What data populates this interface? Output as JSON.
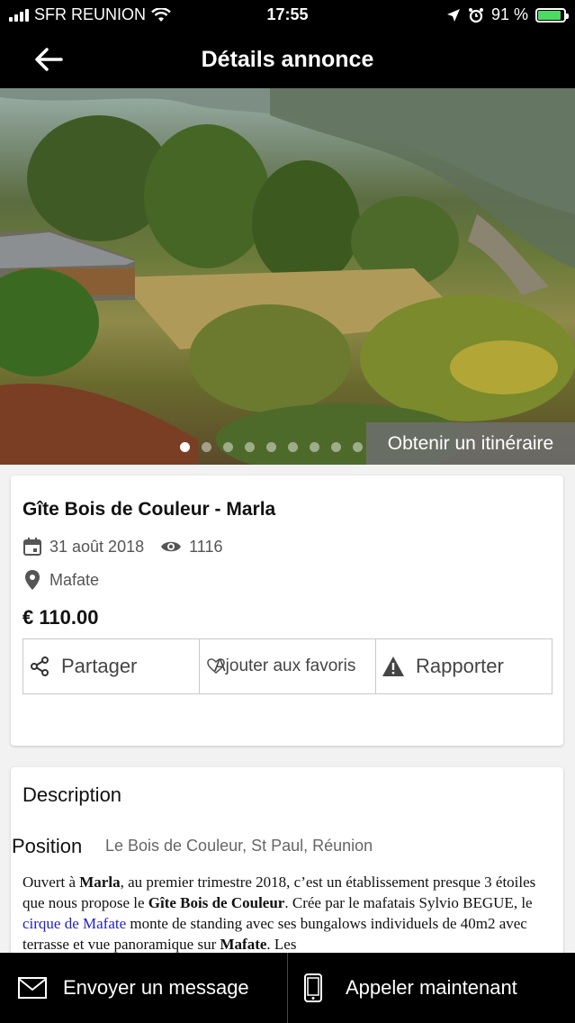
{
  "status_bar": {
    "carrier": "SFR REUNION",
    "time": "17:55",
    "battery": "91 %",
    "battery_level": 0.91
  },
  "nav": {
    "title": "Détails annonce",
    "back_icon": "arrow-left-icon"
  },
  "hero": {
    "itinerary_label": "Obtenir un itinéraire",
    "slide_count": 9,
    "active_slide": 0
  },
  "listing": {
    "title": "Gîte Bois de Couleur - Marla",
    "date": "31 août 2018",
    "views": "1116",
    "location": "Mafate",
    "price": "€ 110.00"
  },
  "actions": {
    "share": "Partager",
    "favorite": "Ajouter aux favoris",
    "report": "Rapporter"
  },
  "description": {
    "title": "Description",
    "position_label": "Position",
    "position_value": "Le Bois de Couleur, St Paul, Réunion",
    "p1": "Ouvert à ",
    "b1": "Marla",
    "p2": ", au premier trimestre 2018, c’est un établissement presque 3 étoiles que nous propose le ",
    "b2": "Gîte Bois de Couleur",
    "p3": ". Crée par le mafatais Sylvio BEGUE, le ",
    "link": "cirque de Mafate",
    "p4": " monte de standing avec ses bungalows individuels de 40m2 avec terrasse et vue panoramique sur ",
    "b3": "Mafate",
    "p5": ". Les"
  },
  "bottom": {
    "message": "Envoyer un message",
    "call": "Appeler maintenant"
  },
  "colors": {
    "bar": "#000000",
    "battery": "#4cd964",
    "link": "#2020c8"
  }
}
